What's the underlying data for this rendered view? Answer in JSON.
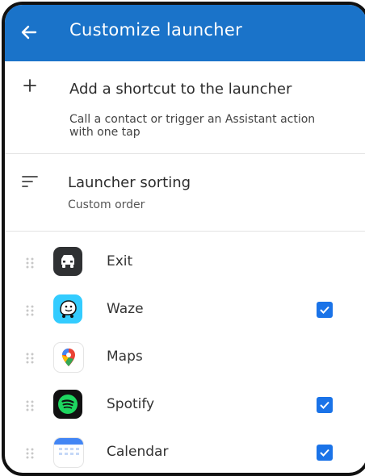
{
  "appbar": {
    "title": "Customize launcher",
    "back_icon": "arrow-left-icon"
  },
  "add_shortcut": {
    "title": "Add a shortcut to the launcher",
    "subtitle": "Call a contact or trigger an Assistant action with one tap",
    "icon": "plus-icon"
  },
  "sorting": {
    "title": "Launcher sorting",
    "value": "Custom order",
    "icon": "sort-icon"
  },
  "apps": [
    {
      "label": "Exit",
      "checked": false
    },
    {
      "label": "Waze",
      "checked": true
    },
    {
      "label": "Maps",
      "checked": false
    },
    {
      "label": "Spotify",
      "checked": true
    },
    {
      "label": "Calendar",
      "checked": true
    }
  ],
  "colors": {
    "appbar": "#1a73c9",
    "checkbox": "#1a73e8"
  }
}
